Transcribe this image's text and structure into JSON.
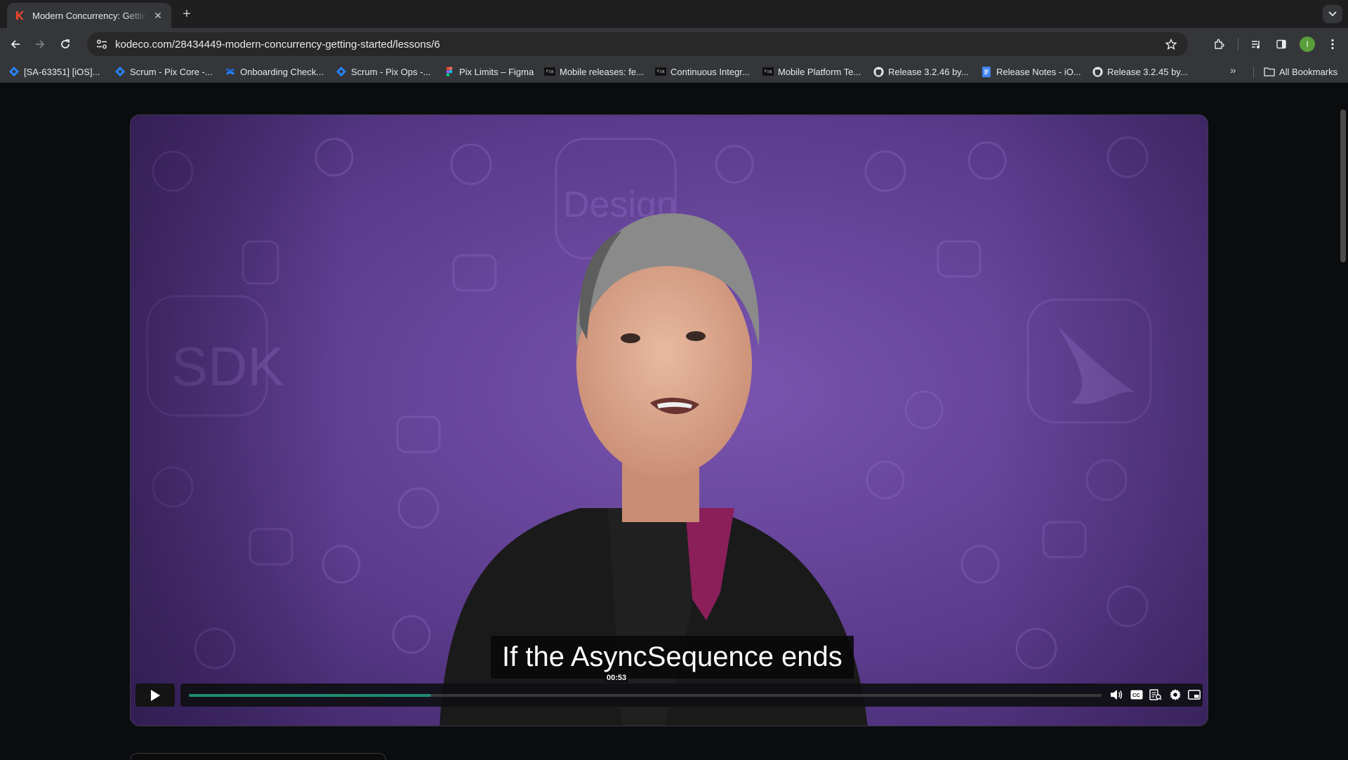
{
  "browser": {
    "tab": {
      "title": "Modern Concurrency: Getting Started",
      "favicon": "kodeco-icon"
    },
    "url": "kodeco.com/28434449-modern-concurrency-getting-started/lessons/6",
    "avatar_initial": "I",
    "bookmarks": [
      {
        "label": "[SA-63351] [iOS]...",
        "icon": "jira-icon"
      },
      {
        "label": "Scrum - Pix Core -...",
        "icon": "jira-icon"
      },
      {
        "label": "Onboarding Check...",
        "icon": "confluence-icon"
      },
      {
        "label": "Scrum - Pix Ops -...",
        "icon": "jira-icon"
      },
      {
        "label": "Pix Limits – Figma",
        "icon": "figma-icon"
      },
      {
        "label": "Mobile releases: fe...",
        "icon": "pix-icon"
      },
      {
        "label": "Continuous Integr...",
        "icon": "pix-icon"
      },
      {
        "label": "Mobile Platform Te...",
        "icon": "pix-icon"
      },
      {
        "label": "Release 3.2.46 by...",
        "icon": "github-icon"
      },
      {
        "label": "Release Notes - iO...",
        "icon": "docs-icon"
      },
      {
        "label": "Release 3.2.45 by...",
        "icon": "github-icon"
      }
    ],
    "all_bookmarks_label": "All Bookmarks"
  },
  "player": {
    "caption": "If the AsyncSequence ends",
    "current_time": "00:53",
    "progress": 0.265,
    "accent": "#1f8a73",
    "background_color": "#5b3b8c"
  }
}
